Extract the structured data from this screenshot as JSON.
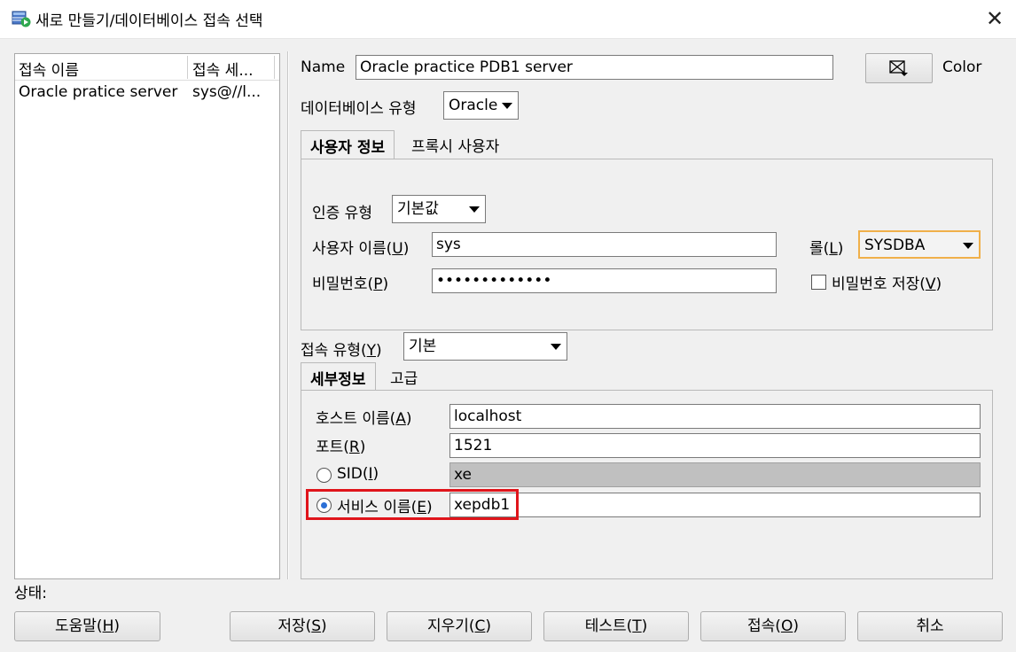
{
  "window": {
    "title": "새로 만들기/데이터베이스 접속 선택",
    "close_symbol": "✕"
  },
  "list": {
    "headers": [
      "접속 이름",
      "접속 세..."
    ],
    "rows": [
      {
        "name": "Oracle pratice server",
        "conn": "sys@//l..."
      }
    ]
  },
  "form": {
    "name_label": "Name",
    "name_value": "Oracle practice PDB1 server",
    "color_label": "Color",
    "dbtype_label": "데이터베이스 유형",
    "dbtype_value": "Oracle",
    "tabs1": [
      "사용자 정보",
      "프록시 사용자"
    ],
    "auth_label": "인증 유형",
    "auth_value": "기본값",
    "user_label_pre": "사용자 이름(",
    "user_label_key": "U",
    "user_label_post": ")",
    "user_value": "sys",
    "role_label_pre": "롤(",
    "role_label_key": "L",
    "role_label_post": ")",
    "role_value": "SYSDBA",
    "pw_label_pre": "비밀번호(",
    "pw_label_key": "P",
    "pw_label_post": ")",
    "pw_value": "•••••••••••••",
    "save_pw_pre": "비밀번호 저장(",
    "save_pw_key": "V",
    "save_pw_post": ")",
    "conn_type_pre": "접속 유형(",
    "conn_type_key": "Y",
    "conn_type_post": ")",
    "conn_type_value": "기본",
    "tabs2": [
      "세부정보",
      "고급"
    ],
    "host_pre": "호스트 이름(",
    "host_key": "A",
    "host_post": ")",
    "host_value": "localhost",
    "port_pre": "포트(",
    "port_key": "R",
    "port_post": ")",
    "port_value": "1521",
    "sid_pre": "SID(",
    "sid_key": "I",
    "sid_post": ")",
    "sid_value": "xe",
    "svc_pre": "서비스 이름(",
    "svc_key": "E",
    "svc_post": ")",
    "svc_value": "xepdb1"
  },
  "status_label": "상태:",
  "buttons": {
    "help": {
      "pre": "도움말(",
      "key": "H",
      "post": ")"
    },
    "save": {
      "pre": "저장(",
      "key": "S",
      "post": ")"
    },
    "clear": {
      "pre": "지우기(",
      "key": "C",
      "post": ")"
    },
    "test": {
      "pre": "테스트(",
      "key": "T",
      "post": ")"
    },
    "connect": {
      "pre": "접속(",
      "key": "O",
      "post": ")"
    },
    "cancel": "취소"
  },
  "colors": {
    "highlight": "#e0151b",
    "radio_checked": "#2b6fd6",
    "role_focus": "#f0b04a"
  }
}
